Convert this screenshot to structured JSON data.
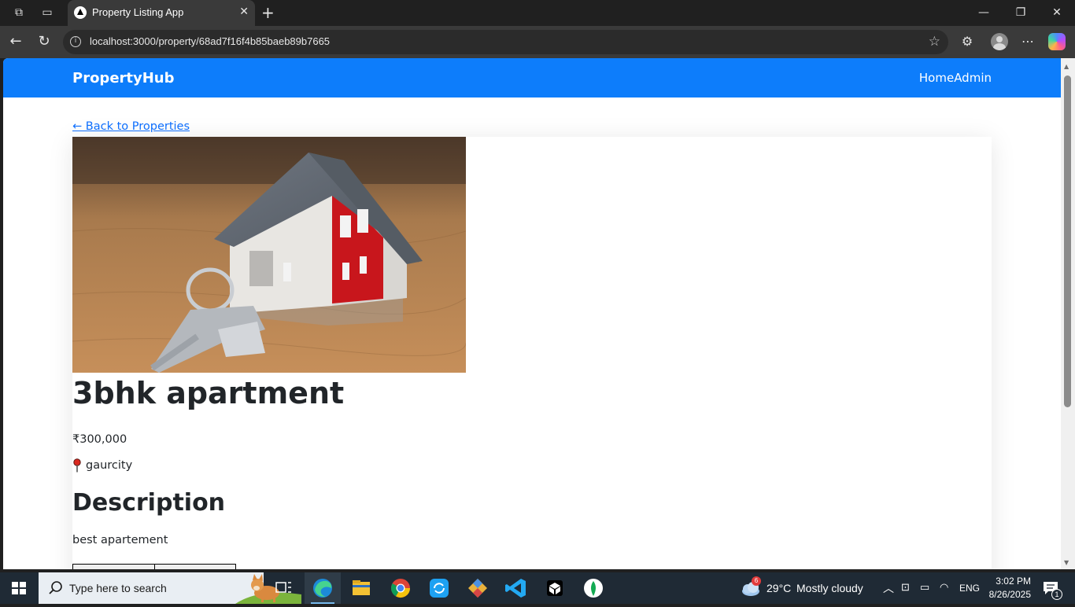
{
  "browser": {
    "tab_title": "Property Listing App",
    "url": "localhost:3000/property/68ad7f16f4b85baeb89b7665"
  },
  "site": {
    "brand": "PropertyHub",
    "nav": [
      "Home",
      "Admin"
    ]
  },
  "page": {
    "back_link": "← Back to Properties",
    "title": "3bhk apartment",
    "price": "₹300,000",
    "location": "gaurcity",
    "description_heading": "Description",
    "description": "best apartement"
  },
  "taskbar": {
    "search_placeholder": "Type here to search",
    "weather_temp": "29°C",
    "weather_desc": "Mostly cloudy",
    "weather_badge": "6",
    "language": "ENG",
    "time": "3:02 PM",
    "date": "8/26/2025",
    "notification_count": "1"
  },
  "colors": {
    "accent": "#0d7dfb",
    "link": "#0d6efd",
    "text": "#212529"
  }
}
